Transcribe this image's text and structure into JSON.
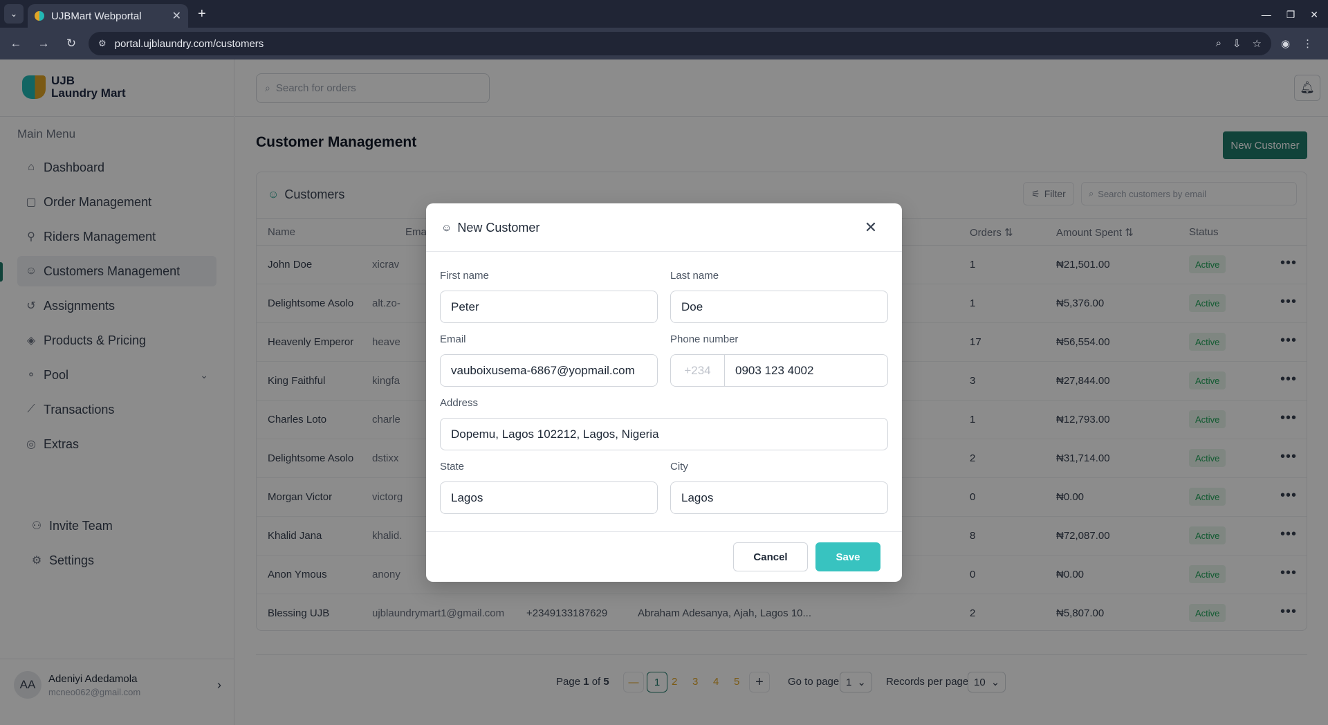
{
  "browser": {
    "tab_title": "UJBMart Webportal",
    "url": "portal.ujblaundry.com/customers"
  },
  "sidebar": {
    "logo_line1": "UJB",
    "logo_line2": "Laundry Mart",
    "menu_title": "Main Menu",
    "items": [
      {
        "label": "Dashboard",
        "icon": "home-icon"
      },
      {
        "label": "Order Management",
        "icon": "bag-icon"
      },
      {
        "label": "Riders Management",
        "icon": "bike-icon"
      },
      {
        "label": "Customers Management",
        "icon": "users-icon"
      },
      {
        "label": "Assignments",
        "icon": "history-icon"
      },
      {
        "label": "Products & Pricing",
        "icon": "tag-icon"
      },
      {
        "label": "Pool",
        "icon": "pool-icon"
      },
      {
        "label": "Transactions",
        "icon": "chart-line-icon"
      },
      {
        "label": "Extras",
        "icon": "globe-icon"
      }
    ],
    "bottom": [
      {
        "label": "Invite Team",
        "icon": "user-plus-icon"
      },
      {
        "label": "Settings",
        "icon": "gear-icon"
      }
    ],
    "user": {
      "initials": "AA",
      "name": "Adeniyi Adedamola",
      "email": "mcneo062@gmail.com"
    }
  },
  "header": {
    "search_placeholder": "Search for orders"
  },
  "main": {
    "title": "Customer Management",
    "new_button": "New Customer",
    "card_title": "Customers",
    "filter_label": "Filter",
    "search_placeholder": "Search customers by email",
    "columns": {
      "name": "Name",
      "email": "Ema",
      "orders": "Orders",
      "amount": "Amount Spent",
      "status": "Status"
    },
    "rows": [
      {
        "name": "John Doe",
        "email": "xicrav",
        "phone": "",
        "address": "",
        "orders": "1",
        "amount": "₦21,501.00",
        "status": "Active"
      },
      {
        "name": "Delightsome Asolo",
        "email": "alt.zo-",
        "phone": "",
        "address": "",
        "orders": "1",
        "amount": "₦5,376.00",
        "status": "Active"
      },
      {
        "name": "Heavenly Emperor",
        "email": "heave",
        "phone": "",
        "address": "",
        "orders": "17",
        "amount": "₦56,554.00",
        "status": "Active"
      },
      {
        "name": "King Faithful",
        "email": "kingfa",
        "phone": "",
        "address": "",
        "orders": "3",
        "amount": "₦27,844.00",
        "status": "Active"
      },
      {
        "name": "Charles Loto",
        "email": "charle",
        "phone": "",
        "address": "",
        "orders": "1",
        "amount": "₦12,793.00",
        "status": "Active"
      },
      {
        "name": "Delightsome Asolo",
        "email": "dstixx",
        "phone": "",
        "address": "",
        "orders": "2",
        "amount": "₦31,714.00",
        "status": "Active"
      },
      {
        "name": "Morgan Victor",
        "email": "victorg",
        "phone": "",
        "address": "",
        "orders": "0",
        "amount": "₦0.00",
        "status": "Active"
      },
      {
        "name": "Khalid Jana",
        "email": "khalid.",
        "phone": "",
        "address": "",
        "orders": "8",
        "amount": "₦72,087.00",
        "status": "Active"
      },
      {
        "name": "Anon Ymous",
        "email": "anony",
        "phone": "",
        "address": "",
        "orders": "0",
        "amount": "₦0.00",
        "status": "Active"
      },
      {
        "name": "Blessing UJB",
        "email": "ujblaundrymart1@gmail.com",
        "phone": "+2349133187629",
        "address": "Abraham Adesanya, Ajah, Lagos 10...",
        "orders": "2",
        "amount": "₦5,807.00",
        "status": "Active"
      }
    ]
  },
  "pagination": {
    "page_text_prefix": "Page ",
    "page_current": "1",
    "page_text_mid": " of ",
    "page_total": "5",
    "prev": "—",
    "pages": [
      "1",
      "2",
      "3",
      "4",
      "5"
    ],
    "next": "+",
    "goto_label": "Go to page",
    "goto_value": "1",
    "records_label": "Records per page",
    "records_value": "10"
  },
  "modal": {
    "title": "New Customer",
    "first_name_label": "First name",
    "first_name_value": "Peter",
    "last_name_label": "Last name",
    "last_name_value": "Doe",
    "email_label": "Email",
    "email_value": "vauboixusema-6867@yopmail.com",
    "phone_label": "Phone number",
    "phone_code": "+234",
    "phone_value": "0903 123 4002",
    "address_label": "Address",
    "address_value": "Dopemu, Lagos 102212, Lagos, Nigeria",
    "state_label": "State",
    "state_value": "Lagos",
    "city_label": "City",
    "city_value": "Lagos",
    "cancel": "Cancel",
    "save": "Save"
  },
  "colors": {
    "brand_teal": "#1f7a6b",
    "save_teal": "#38c3c0",
    "accent_orange": "#e0a526",
    "active_green": "#22a55a"
  }
}
